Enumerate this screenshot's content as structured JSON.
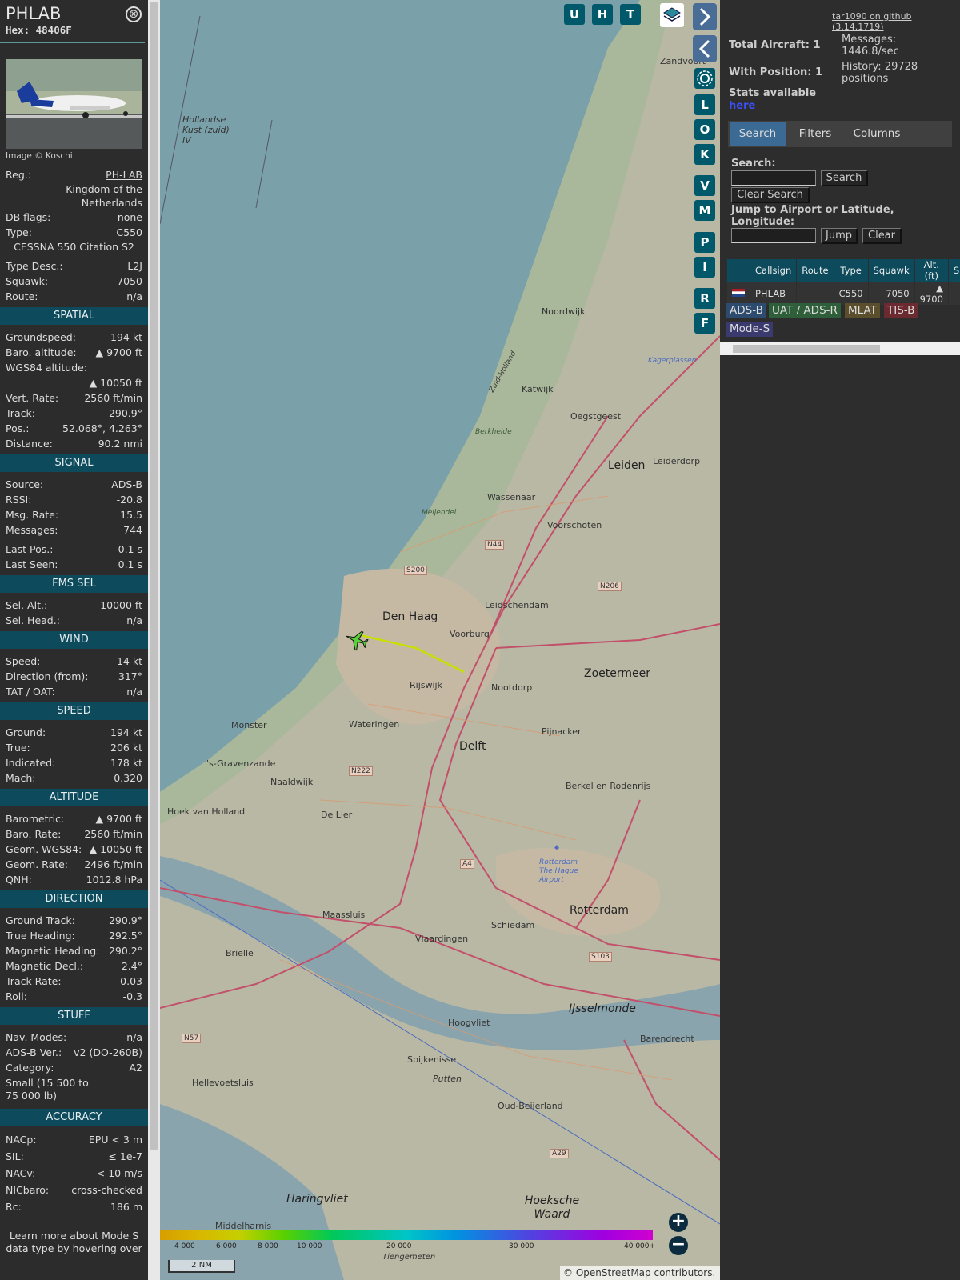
{
  "sidebar": {
    "callsign": "PHLAB",
    "hex": "Hex: 48406F",
    "close_glyph": "⊗",
    "image_credit": "Image © Koschi",
    "fields": [
      {
        "k": "Reg.:",
        "v": "PH-LAB"
      },
      {
        "k": "country",
        "v": "Kingdom of the Netherlands"
      },
      {
        "k": "DB flags:",
        "v": "none"
      },
      {
        "k": "Type:",
        "v": "C550"
      },
      {
        "k": "typename",
        "v": "CESSNA 550 Citation S2"
      },
      {
        "k": "Type Desc.:",
        "v": "L2J"
      },
      {
        "k": "Squawk:",
        "v": "7050"
      },
      {
        "k": "Route:",
        "v": "n/a"
      }
    ],
    "spatial": {
      "title": "SPATIAL",
      "rows": [
        {
          "k": "Groundspeed:",
          "v": "194 kt"
        },
        {
          "k": "Baro. altitude:",
          "v": "▲ 9700 ft"
        },
        {
          "k": "WGS84 altitude:",
          "v": "▲ 10050 ft"
        },
        {
          "k": "Vert. Rate:",
          "v": "2560 ft/min"
        },
        {
          "k": "Track:",
          "v": "290.9°"
        },
        {
          "k": "Pos.:",
          "v": "52.068°, 4.263°"
        },
        {
          "k": "Distance:",
          "v": "90.2 nmi"
        }
      ]
    },
    "signal": {
      "title": "SIGNAL",
      "rows": [
        {
          "k": "Source:",
          "v": "ADS-B"
        },
        {
          "k": "RSSI:",
          "v": "-20.8"
        },
        {
          "k": "Msg. Rate:",
          "v": "15.5"
        },
        {
          "k": "Messages:",
          "v": "744"
        },
        {
          "k": "Last Pos.:",
          "v": "0.1 s"
        },
        {
          "k": "Last Seen:",
          "v": "0.1 s"
        }
      ]
    },
    "fms": {
      "title": "FMS SEL",
      "rows": [
        {
          "k": "Sel. Alt.:",
          "v": "10000 ft"
        },
        {
          "k": "Sel. Head.:",
          "v": "n/a"
        }
      ]
    },
    "wind": {
      "title": "WIND",
      "rows": [
        {
          "k": "Speed:",
          "v": "14 kt"
        },
        {
          "k": "Direction (from):",
          "v": "317°"
        },
        {
          "k": "TAT / OAT:",
          "v": "n/a"
        }
      ]
    },
    "speed": {
      "title": "SPEED",
      "rows": [
        {
          "k": "Ground:",
          "v": "194 kt"
        },
        {
          "k": "True:",
          "v": "206 kt"
        },
        {
          "k": "Indicated:",
          "v": "178 kt"
        },
        {
          "k": "Mach:",
          "v": "0.320"
        }
      ]
    },
    "altitude": {
      "title": "ALTITUDE",
      "rows": [
        {
          "k": "Barometric:",
          "v": "▲ 9700 ft"
        },
        {
          "k": "Baro. Rate:",
          "v": "2560 ft/min"
        },
        {
          "k": "Geom. WGS84:",
          "v": "▲ 10050 ft"
        },
        {
          "k": "Geom. Rate:",
          "v": "2496 ft/min"
        },
        {
          "k": "QNH:",
          "v": "1012.8 hPa"
        }
      ]
    },
    "direction": {
      "title": "DIRECTION",
      "rows": [
        {
          "k": "Ground Track:",
          "v": "290.9°"
        },
        {
          "k": "True Heading:",
          "v": "292.5°"
        },
        {
          "k": "Magnetic Heading:",
          "v": "290.2°"
        },
        {
          "k": "Magnetic Decl.:",
          "v": "2.4°"
        },
        {
          "k": "Track Rate:",
          "v": "-0.03"
        },
        {
          "k": "Roll:",
          "v": "-0.3"
        }
      ]
    },
    "stuff": {
      "title": "STUFF",
      "rows": [
        {
          "k": "Nav. Modes:",
          "v": "n/a"
        },
        {
          "k": "ADS-B Ver.:",
          "v": "v2 (DO-260B)"
        },
        {
          "k": "Category:",
          "v": "A2"
        }
      ],
      "category_desc": "Small (15 500 to 75 000 lb)"
    },
    "accuracy": {
      "title": "ACCURACY",
      "rows": [
        {
          "k": "NACp:",
          "v": "EPU < 3 m"
        },
        {
          "k": "SIL:",
          "v": "≤ 1e-7"
        },
        {
          "k": "NACv:",
          "v": "< 10 m/s"
        },
        {
          "k": "NICbaro:",
          "v": "cross-checked"
        },
        {
          "k": "Rc:",
          "v": "186 m"
        }
      ]
    },
    "footer_text": "Learn more about Mode S data type by hovering over"
  },
  "map": {
    "top_buttons": [
      "U",
      "H",
      "T"
    ],
    "side_buttons": [
      "L",
      "O",
      "K",
      "V",
      "M",
      "P",
      "I",
      "R",
      "F"
    ],
    "labels": [
      {
        "t": "Zandvoort"
      },
      {
        "t": "Hollandse Kust (zuid) IV"
      },
      {
        "t": "Noordwijk"
      },
      {
        "t": "Katwijk"
      },
      {
        "t": "Oegstgeest"
      },
      {
        "t": "Leiden"
      },
      {
        "t": "Leiderdorp"
      },
      {
        "t": "Wassenaar"
      },
      {
        "t": "Voorschoten"
      },
      {
        "t": "Den Haag"
      },
      {
        "t": "Leidschendam"
      },
      {
        "t": "Voorburg"
      },
      {
        "t": "Zoetermeer"
      },
      {
        "t": "Rijswijk"
      },
      {
        "t": "Nootdorp"
      },
      {
        "t": "Monster"
      },
      {
        "t": "Wateringen"
      },
      {
        "t": "Pijnacker"
      },
      {
        "t": "Delft"
      },
      {
        "t": "'s-Gravenzande"
      },
      {
        "t": "Naaldwijk"
      },
      {
        "t": "Berkel en Rodenrijs"
      },
      {
        "t": "Hoek van Holland"
      },
      {
        "t": "De Lier"
      },
      {
        "t": "Maassluis"
      },
      {
        "t": "Schiedam"
      },
      {
        "t": "Rotterdam"
      },
      {
        "t": "Vlaardingen"
      },
      {
        "t": "Brielle"
      },
      {
        "t": "Hoogvliet"
      },
      {
        "t": "IJsselmonde"
      },
      {
        "t": "Barendrecht"
      },
      {
        "t": "Spijkenisse"
      },
      {
        "t": "Putten"
      },
      {
        "t": "Hellevoetsluis"
      },
      {
        "t": "Oud-Beijerland"
      },
      {
        "t": "Haringvliet"
      },
      {
        "t": "Hoeksche Waard"
      },
      {
        "t": "Middelharnis"
      },
      {
        "t": "Tiengemeten"
      },
      {
        "t": "Berkheide"
      },
      {
        "t": "Meijendel"
      },
      {
        "t": "Rotterdam The Hague Airport"
      },
      {
        "t": "Kagerplassen"
      },
      {
        "t": "Zuid-Holland"
      }
    ],
    "roads": [
      "N44",
      "S200",
      "N206",
      "N222",
      "A4",
      "S103",
      "N57",
      "A29"
    ],
    "legend_ticks": [
      "4 000",
      "6 000",
      "8 000",
      "10 000",
      "20 000",
      "30 000",
      "40 000+"
    ],
    "scale": "2 NM",
    "attribution": "© OpenStreetMap contributors."
  },
  "panel": {
    "github": "tar1090 on github (3.14.1719)",
    "total_aircraft": "Total Aircraft: 1",
    "with_position": "With Position: 1",
    "messages": "Messages: 1446.8/sec",
    "history": "History: 29728 positions",
    "stats_label": "Stats available",
    "stats_link": "here",
    "tabs": [
      "Search",
      "Filters",
      "Columns"
    ],
    "search_label": "Search:",
    "search_button": "Search",
    "clear_search_button": "Clear Search",
    "jump_label": "Jump to Airport or Latitude, Longitude:",
    "jump_button": "Jump",
    "clear_button": "Clear",
    "table_headers": [
      "",
      "Callsign",
      "Route",
      "Type",
      "Squawk",
      "Alt. (ft)",
      "Spd"
    ],
    "table_rows": [
      {
        "callsign": "PHLAB",
        "route": "",
        "type": "C550",
        "squawk": "7050",
        "alt": "▲ 9700",
        "spd": ""
      }
    ],
    "chips": [
      {
        "label": "ADS-B",
        "bg": "#2c4b6e",
        "fg": "#ddd"
      },
      {
        "label": "UAT / ADS-R",
        "bg": "#2f5e3a",
        "fg": "#ddd"
      },
      {
        "label": "MLAT",
        "bg": "#5a4e2c",
        "fg": "#ddd"
      },
      {
        "label": "TIS-B",
        "bg": "#6b2a2f",
        "fg": "#ddd"
      },
      {
        "label": "Mode-S",
        "bg": "#3a3a6e",
        "fg": "#ddd"
      }
    ]
  }
}
